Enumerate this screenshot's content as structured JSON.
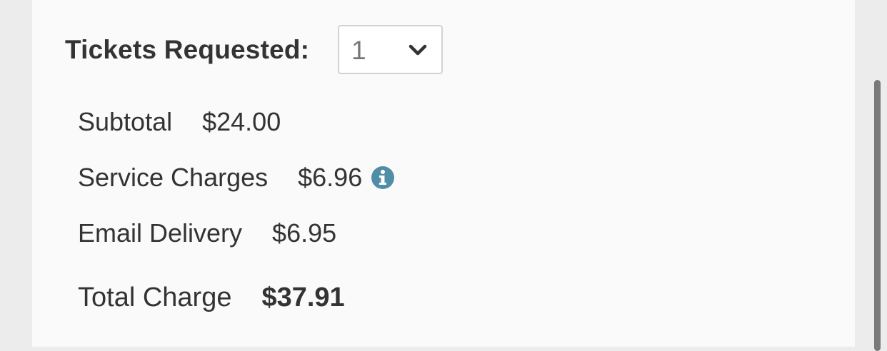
{
  "tickets": {
    "label": "Tickets Requested:",
    "selected_quantity": "1"
  },
  "summary": {
    "subtotal_label": "Subtotal",
    "subtotal_value": "$24.00",
    "service_label": "Service Charges",
    "service_value": "$6.96",
    "service_info_icon": "info-circle-icon",
    "email_label": "Email Delivery",
    "email_value": "$6.95",
    "total_label": "Total Charge",
    "total_value": "$37.91"
  },
  "colors": {
    "info_icon": "#4f8ea6",
    "text": "#333333",
    "panel_background": "#fafafa",
    "page_background": "#ececec"
  }
}
